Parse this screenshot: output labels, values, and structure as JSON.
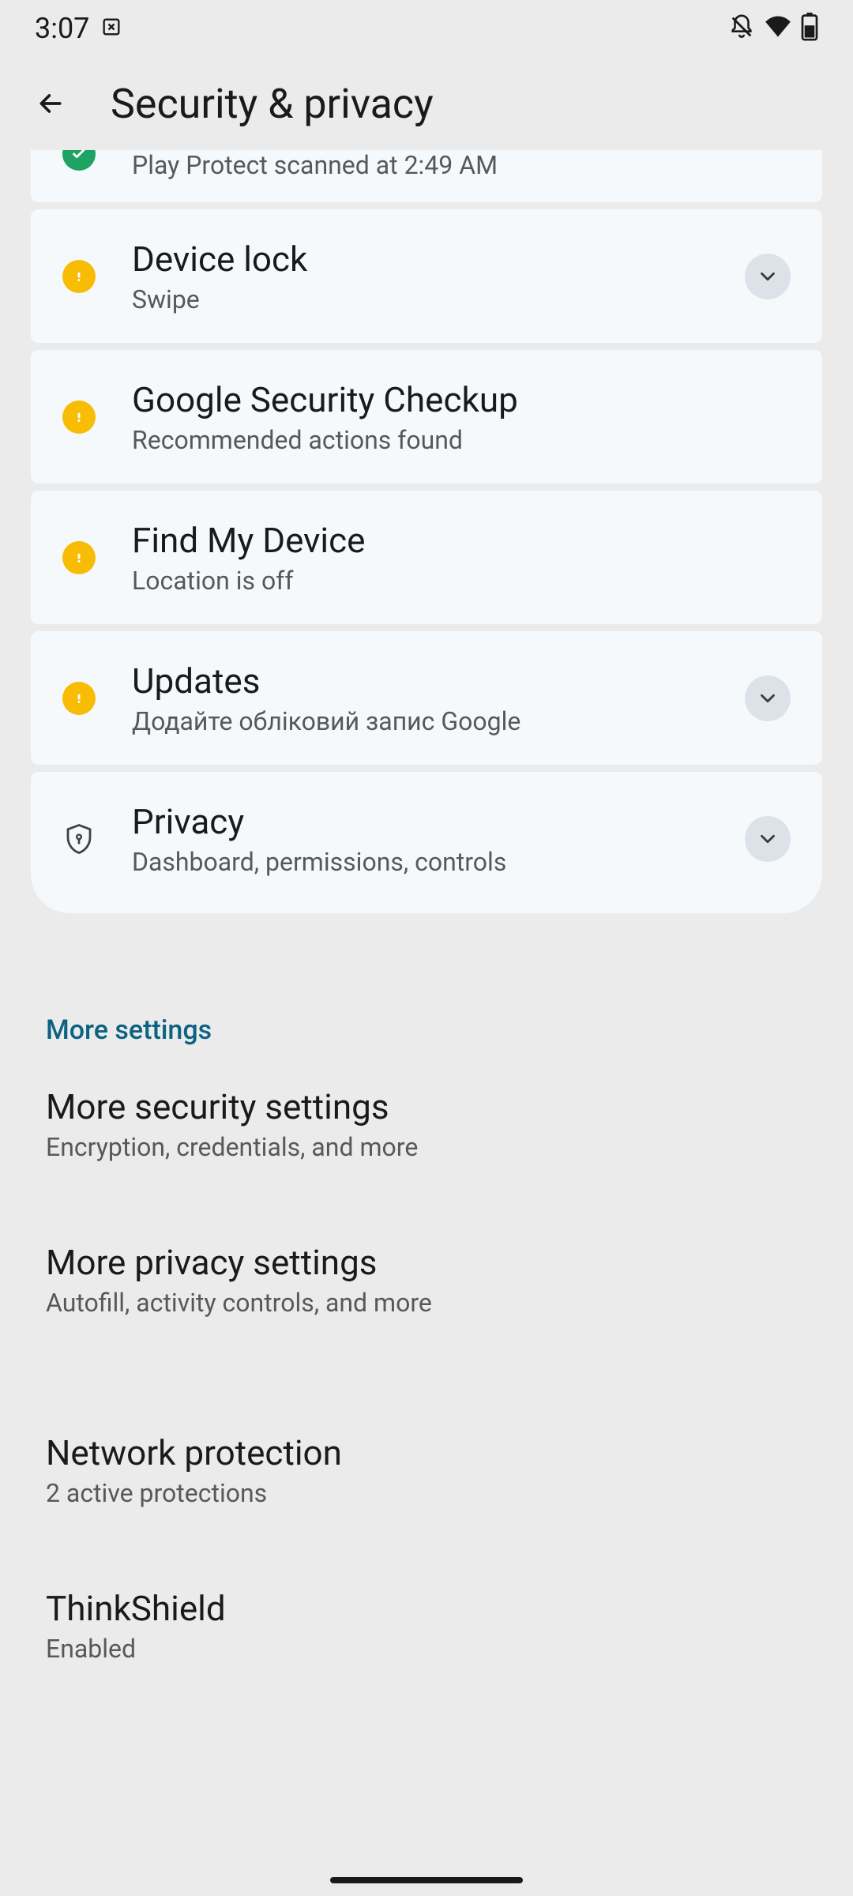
{
  "status": {
    "time": "3:07"
  },
  "header": {
    "title": "Security & privacy"
  },
  "cards": {
    "app_security": {
      "subtitle": "Play Protect scanned at 2:49 AM"
    },
    "device_lock": {
      "title": "Device lock",
      "subtitle": "Swipe"
    },
    "google_checkup": {
      "title": "Google Security Checkup",
      "subtitle": "Recommended actions found"
    },
    "find_device": {
      "title": "Find My Device",
      "subtitle": "Location is off"
    },
    "updates": {
      "title": "Updates",
      "subtitle": "Додайте обліковий запис Google"
    },
    "privacy": {
      "title": "Privacy",
      "subtitle": "Dashboard, permissions, controls"
    }
  },
  "section_header": "More settings",
  "settings": {
    "more_security": {
      "title": "More security settings",
      "subtitle": "Encryption, credentials, and more"
    },
    "more_privacy": {
      "title": "More privacy settings",
      "subtitle": "Autofill, activity controls, and more"
    },
    "network": {
      "title": "Network protection",
      "subtitle": "2 active protections"
    },
    "thinkshield": {
      "title": "ThinkShield",
      "subtitle": "Enabled"
    }
  }
}
